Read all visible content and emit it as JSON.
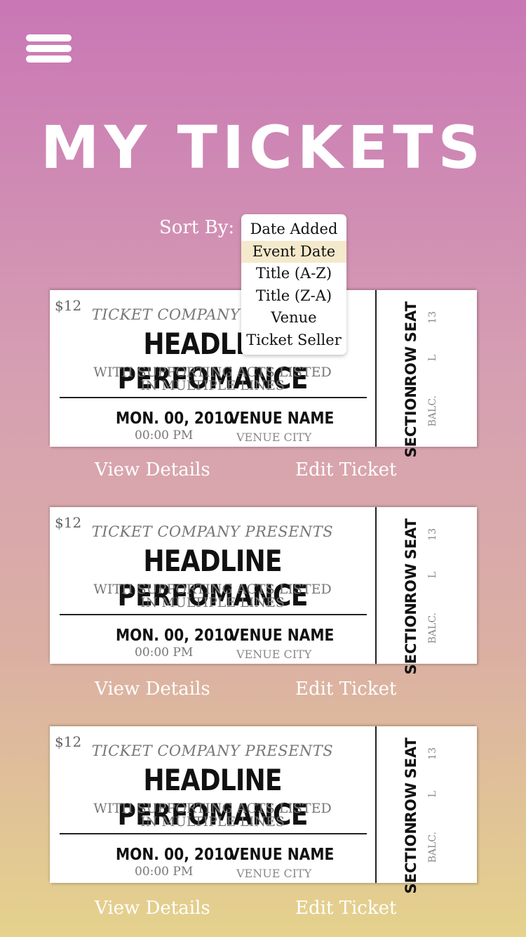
{
  "header": {
    "menu_icon": "hamburger-menu-icon",
    "title": "MY TICKETS"
  },
  "sort": {
    "label": "Sort By:",
    "options": [
      "Date Added",
      "Event Date",
      "Title (A-Z)",
      "Title (Z-A)",
      "Venue",
      "Ticket Seller"
    ],
    "selected": "Event Date"
  },
  "tickets": [
    {
      "price": "$12",
      "presenter": "TICKET COMPANY PRESENTS",
      "headline": "HEADLINE PERFOMANCE",
      "support_line1": "WITH SUPPORTING ACTS LISTED",
      "support_line2": "IN MULTIPLE LINES",
      "date": "MON. 00, 2010",
      "time": "00:00 PM",
      "venue": "VENUE NAME",
      "city": "VENUE CITY",
      "seat_label": "SEAT",
      "seat_value": "13",
      "row_label": "ROW",
      "row_value": "L",
      "section_label": "SECTION",
      "section_value": "BALC.",
      "view_label": "View Details",
      "edit_label": "Edit Ticket"
    },
    {
      "price": "$12",
      "presenter": "TICKET COMPANY PRESENTS",
      "headline": "HEADLINE PERFOMANCE",
      "support_line1": "WITH SUPPORTING ACTS LISTED",
      "support_line2": "IN MULTIPLE LINES",
      "date": "MON. 00, 2010",
      "time": "00:00 PM",
      "venue": "VENUE NAME",
      "city": "VENUE CITY",
      "seat_label": "SEAT",
      "seat_value": "13",
      "row_label": "ROW",
      "row_value": "L",
      "section_label": "SECTION",
      "section_value": "BALC.",
      "view_label": "View Details",
      "edit_label": "Edit Ticket"
    },
    {
      "price": "$12",
      "presenter": "TICKET COMPANY PRESENTS",
      "headline": "HEADLINE PERFOMANCE",
      "support_line1": "WITH SUPPORTING ACTS LISTED",
      "support_line2": "IN MULTIPLE LINES",
      "date": "MON. 00, 2010",
      "time": "00:00 PM",
      "venue": "VENUE NAME",
      "city": "VENUE CITY",
      "seat_label": "SEAT",
      "seat_value": "13",
      "row_label": "ROW",
      "row_value": "L",
      "section_label": "SECTION",
      "section_value": "BALC.",
      "view_label": "View Details",
      "edit_label": "Edit Ticket"
    }
  ]
}
